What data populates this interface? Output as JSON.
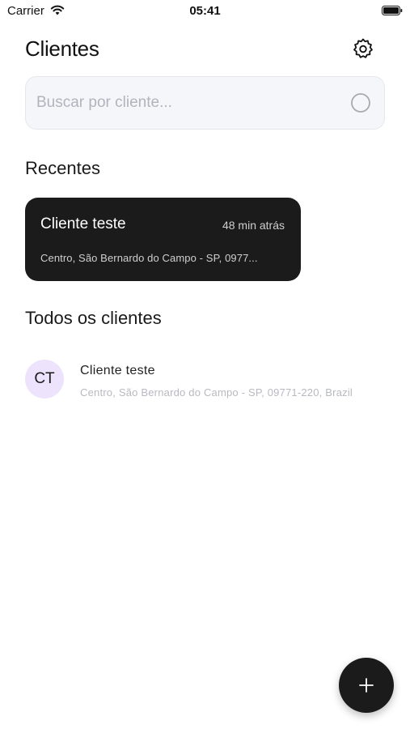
{
  "status_bar": {
    "carrier": "Carrier",
    "time": "05:41",
    "icons": [
      "wifi-icon",
      "battery-icon"
    ]
  },
  "header": {
    "title": "Clientes",
    "settings_icon": "gear-icon"
  },
  "search": {
    "placeholder": "Buscar por cliente...",
    "value": "",
    "icon": "search-icon"
  },
  "recent": {
    "title": "Recentes",
    "items": [
      {
        "name": "Cliente teste",
        "time": "48 min atrás",
        "address": "Centro, São Bernardo do Campo - SP, 0977..."
      }
    ]
  },
  "all_clients": {
    "title": "Todos os clientes",
    "items": [
      {
        "initials": "CT",
        "name": "Cliente teste",
        "address": "Centro, São Bernardo do Campo - SP, 09771-220, Brazil"
      }
    ]
  },
  "fab": {
    "icon": "plus-icon"
  },
  "colors": {
    "card_background": "#1b1b1b",
    "avatar_background": "#ede3fc",
    "search_background": "#f5f6fa",
    "fab_background": "#1b1b1b"
  }
}
